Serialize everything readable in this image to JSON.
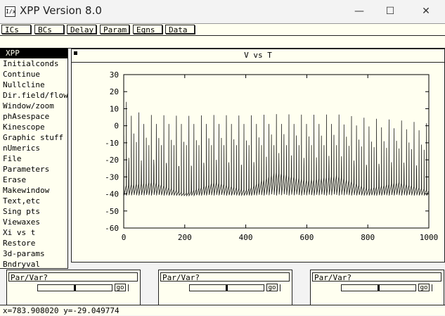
{
  "window": {
    "title": "XPP Version 8.0",
    "icon": "xpp-icon",
    "controls": [
      "minimize-icon",
      "maximize-icon",
      "close-icon"
    ]
  },
  "toolbar": {
    "buttons": [
      "ICs",
      "BCs",
      "Delay",
      "Param",
      "Eqns",
      "Data"
    ]
  },
  "menu": {
    "items": [
      "XPP",
      "Initialconds",
      "Continue",
      "Nullcline",
      "Dir.field/flow",
      "Window/zoom",
      "phAsespace",
      "Kinescope",
      "Graphic stuff",
      "nUmerics",
      "File",
      "Parameters",
      "Erase",
      "Makewindow",
      "Text,etc",
      "Sing pts",
      "Viewaxes",
      "Xi vs t",
      "Restore",
      "3d-params",
      "Bndryval"
    ],
    "selected_index": 0
  },
  "graph": {
    "caption": "V vs T"
  },
  "sliders": [
    {
      "label": "Par/Var?",
      "go": "go",
      "level": 0.5
    },
    {
      "label": "Par/Var?",
      "go": "go",
      "level": 0.5
    },
    {
      "label": "Par/Var?",
      "go": "go",
      "level": 0.5
    }
  ],
  "status": {
    "text": "x=783.908020 y=-29.049774"
  },
  "chart_data": {
    "type": "line",
    "title": "V vs T",
    "xlabel": "",
    "ylabel": "",
    "xlim": [
      0,
      1000
    ],
    "ylim": [
      -60,
      30
    ],
    "xticks": [
      0,
      200,
      400,
      600,
      800,
      1000
    ],
    "yticks": [
      30,
      20,
      10,
      0,
      -10,
      -20,
      -30,
      -40,
      -50,
      -60
    ],
    "grid": false,
    "series": [
      {
        "spike_peak_start": 20,
        "spike_peak_steady": 10,
        "spike_peak_end": 5,
        "trough": -41,
        "spike_period": 8.2,
        "subthreshold_envelope": {
          "x": [
            0,
            100,
            200,
            300,
            400,
            500,
            600,
            700,
            800,
            900,
            1000
          ],
          "y": [
            -35,
            -33,
            -40,
            -33,
            -38,
            -27,
            -32,
            -29,
            -37,
            -33,
            -38
          ]
        }
      }
    ]
  }
}
